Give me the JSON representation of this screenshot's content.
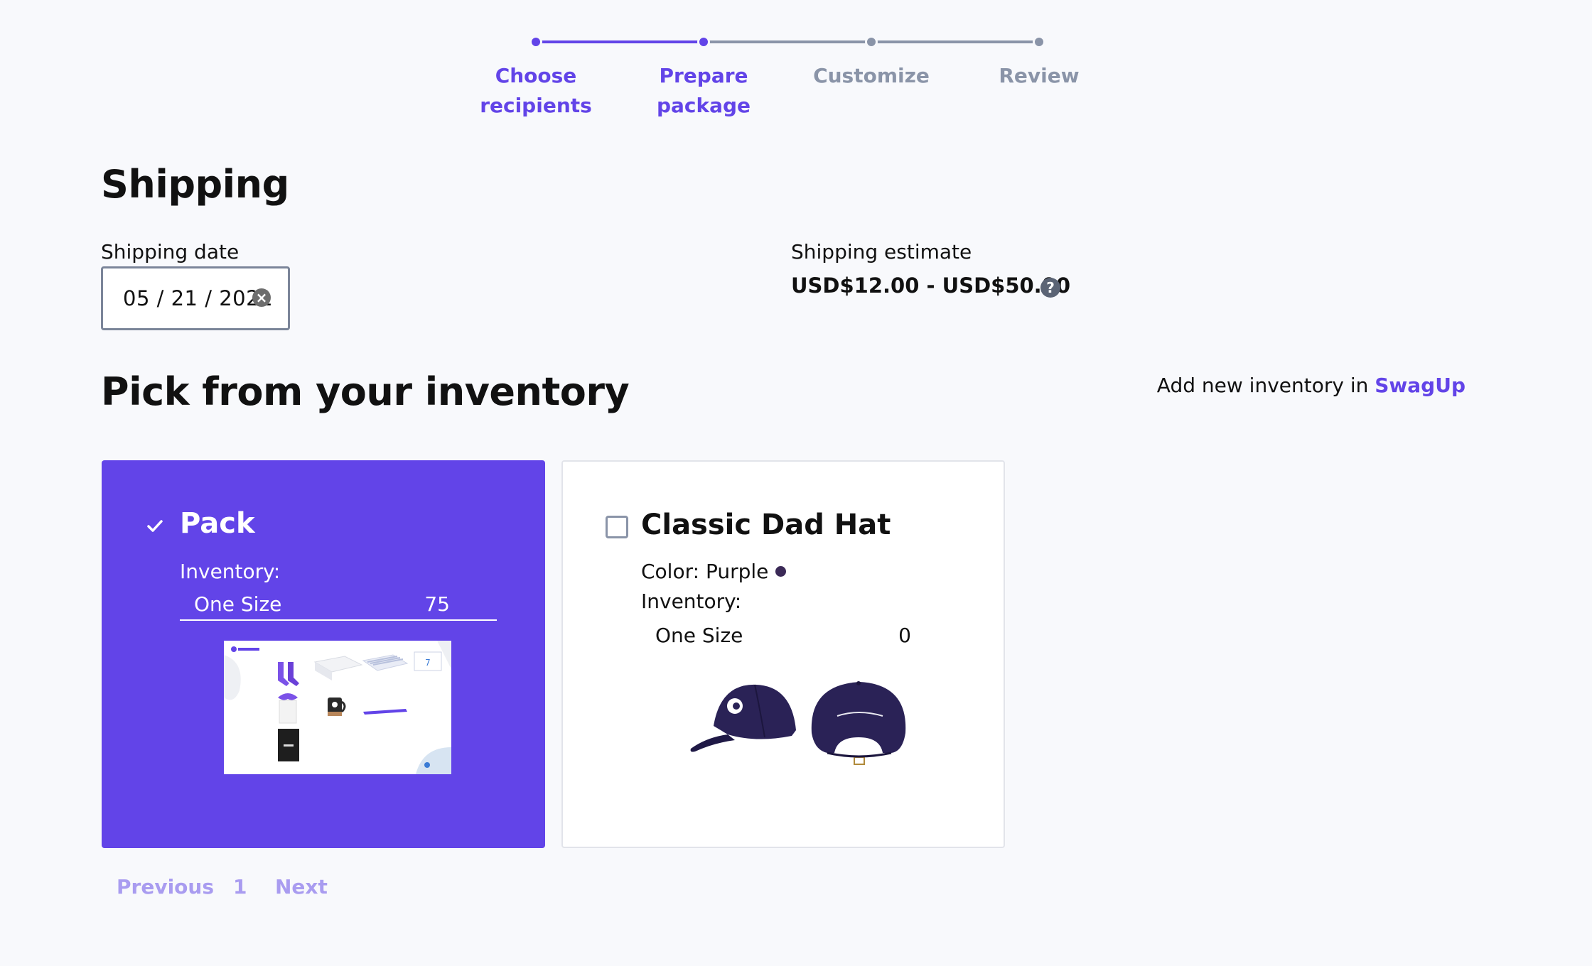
{
  "stepper": {
    "steps": [
      {
        "line1": "Choose",
        "line2": "recipients",
        "state": "done"
      },
      {
        "line1": "Prepare",
        "line2": "package",
        "state": "active"
      },
      {
        "line1": "Customize",
        "line2": "",
        "state": "todo"
      },
      {
        "line1": "Review",
        "line2": "",
        "state": "todo"
      }
    ],
    "colors": {
      "active": "#6244e8",
      "inactive": "#8a94a8"
    }
  },
  "shipping": {
    "title": "Shipping",
    "date_label": "Shipping date",
    "date_value": "05 / 21 / 2021",
    "estimate_label": "Shipping estimate",
    "estimate_value": "USD$12.00 - USD$50.00",
    "clear_icon": "clear-circle-icon",
    "help_icon": "question-circle-icon"
  },
  "inventory": {
    "title": "Pick from your inventory",
    "add_text": "Add new inventory in ",
    "add_link": "SwagUp",
    "cards": [
      {
        "name": "Pack",
        "selected": true,
        "inventory_label": "Inventory:",
        "rows": [
          {
            "size": "One Size",
            "qty": "75"
          }
        ]
      },
      {
        "name": "Classic Dad Hat",
        "selected": false,
        "color_label": "Color: Purple",
        "color_hex": "#3b2a57",
        "inventory_label": "Inventory:",
        "rows": [
          {
            "size": "One Size",
            "qty": "0"
          }
        ]
      }
    ]
  },
  "pagination": {
    "previous": "Previous",
    "page": "1",
    "next": "Next"
  },
  "colors": {
    "brand": "#6244e8",
    "background": "#f8f9fc"
  }
}
